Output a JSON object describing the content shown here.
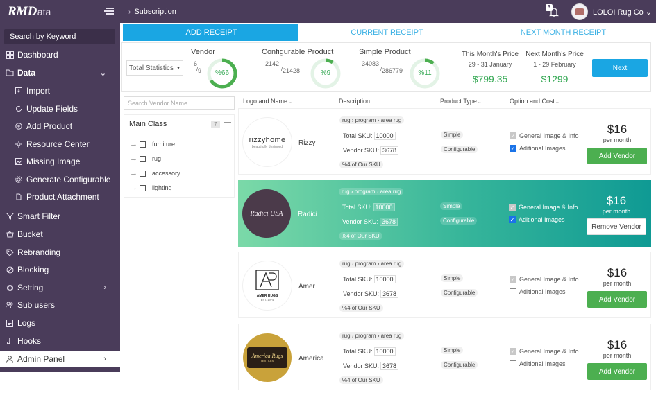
{
  "app": {
    "logo_text": "RMD",
    "logo_sub": "ata"
  },
  "sidebar": {
    "search_placeholder": "Search by Keyword",
    "items": [
      {
        "label": "Dashboard"
      },
      {
        "label": "Data"
      },
      {
        "label": "Import"
      },
      {
        "label": "Update Fields"
      },
      {
        "label": "Add Product"
      },
      {
        "label": "Resource Center"
      },
      {
        "label": "Missing Image"
      },
      {
        "label": "Generate Configurable"
      },
      {
        "label": "Product Attachment"
      },
      {
        "label": "Smart Filter"
      },
      {
        "label": "Bucket"
      },
      {
        "label": "Rebranding"
      },
      {
        "label": "Blocking"
      },
      {
        "label": "Setting"
      },
      {
        "label": "Sub users"
      },
      {
        "label": "Logs"
      },
      {
        "label": "Hooks"
      },
      {
        "label": "Admin Panel"
      }
    ]
  },
  "header": {
    "breadcrumb": "Subscription",
    "notification_count": "3",
    "company": "LOLOI Rug Co"
  },
  "tabs": [
    {
      "label": "ADD RECEIPT",
      "active": true
    },
    {
      "label": "CURRENT RECEIPT",
      "active": false
    },
    {
      "label": "NEXT MONTH RECEIPT",
      "active": false
    }
  ],
  "stats": {
    "select_value": "Total Statistics",
    "vendor": {
      "label": "Vendor",
      "num": "6",
      "den": "9",
      "pct": "%66",
      "value": 0.66
    },
    "configurable": {
      "label": "Configurable Product",
      "num": "2142",
      "den": "21428",
      "pct": "%9",
      "value": 0.09
    },
    "simple": {
      "label": "Simple Product",
      "num": "34083",
      "den": "286779",
      "pct": "%11",
      "value": 0.11
    },
    "this_month": {
      "label": "This Month's Price",
      "range": "29 - 31 January",
      "price": "$799.35"
    },
    "next_month": {
      "label": "Next Month's Price",
      "range": "1 - 29 February",
      "price": "$1299"
    },
    "next_button": "Next"
  },
  "filter": {
    "search_placeholder": "Search Vendor Name",
    "class_title": "Main Class",
    "class_count": "7",
    "classes": [
      "furniture",
      "rug",
      "accessory",
      "lighting"
    ]
  },
  "columns": {
    "logo_name": "Logo and Name",
    "description": "Description",
    "product_type": "Product Type",
    "option_cost": "Option and Cost"
  },
  "vendors": [
    {
      "name": "Rizzy",
      "logo_text": "rizzyhome",
      "logo_sub": "beautifully designed",
      "tags": [
        "rug",
        "program",
        "area rug"
      ],
      "total_sku_label": "Total SKU:",
      "total_sku": "10000",
      "vendor_sku_label": "Vendor SKU:",
      "vendor_sku": "3678",
      "share": "%4 of Our SKU",
      "types": [
        "Simple",
        "Configurable"
      ],
      "opt1": "General Image & Info",
      "opt2": "Aditional Images",
      "opt2_checked": true,
      "cost": "$16",
      "per": "per month",
      "button": "Add Vendor"
    },
    {
      "name": "Radici",
      "logo_text": "Radici USA",
      "tags": [
        "rug",
        "program",
        "area rug"
      ],
      "total_sku_label": "Total SKU:",
      "total_sku": "10000",
      "vendor_sku_label": "Vendor SKU:",
      "vendor_sku": "3678",
      "share": "%4 of Our SKU",
      "types": [
        "Simple",
        "Configurable"
      ],
      "opt1": "General Image & Info",
      "opt2": "Aditional Images",
      "opt2_checked": true,
      "cost": "$16",
      "per": "per month",
      "button": "Remove Vendor"
    },
    {
      "name": "Amer",
      "logo_text": "AMER RUGS",
      "logo_sub": "EST. 1974",
      "tags": [
        "rug",
        "program",
        "area rug"
      ],
      "total_sku_label": "Total SKU:",
      "total_sku": "10000",
      "vendor_sku_label": "Vendor SKU:",
      "vendor_sku": "3678",
      "share": "%4 of Our SKU",
      "types": [
        "Simple",
        "Configurable"
      ],
      "opt1": "General Image & Info",
      "opt2": "Aditional Images",
      "opt2_checked": false,
      "cost": "$16",
      "per": "per month",
      "button": "Add Vendor"
    },
    {
      "name": "America",
      "logo_text": "America Rugs",
      "logo_sub": "TEXTILES",
      "tags": [
        "rug",
        "program",
        "area rug"
      ],
      "total_sku_label": "Total SKU:",
      "total_sku": "10000",
      "vendor_sku_label": "Vendor SKU:",
      "vendor_sku": "3678",
      "share": "%4 of Our SKU",
      "types": [
        "Simple",
        "Configurable"
      ],
      "opt1": "General Image & Info",
      "opt2": "Aditional Images",
      "opt2_checked": false,
      "cost": "$16",
      "per": "per month",
      "button": "Add Vendor"
    }
  ],
  "colors": {
    "sidebar": "#4a3c5a",
    "accent": "#1aa6e3",
    "green": "#4caf50",
    "price_green": "#34a853",
    "selected_gradient_start": "#7bd9a8",
    "selected_gradient_end": "#0f9a94"
  },
  "icons": {
    "dashboard": "grid-icon",
    "data": "folder-icon",
    "import": "import-icon",
    "update": "refresh-icon",
    "add": "plus-circle-icon",
    "resource": "resource-icon",
    "missing": "image-icon",
    "generate": "settings-icon",
    "attachment": "attachment-icon",
    "filter": "filter-icon",
    "bucket": "bucket-icon",
    "rebranding": "tag-icon",
    "blocking": "block-icon",
    "setting": "gear-icon",
    "subusers": "users-icon",
    "logs": "log-icon",
    "hooks": "hook-icon",
    "admin": "user-icon"
  }
}
